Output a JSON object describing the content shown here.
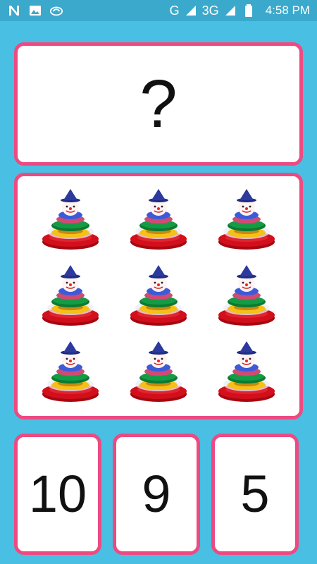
{
  "status_bar": {
    "left_icons": [
      "n-icon",
      "image-icon",
      "cloud-icon"
    ],
    "network_g": "G",
    "network_3g": "3G",
    "time": "4:58 PM"
  },
  "question": {
    "text": "?"
  },
  "objects": {
    "name": "stacking-ring-toy-icon",
    "count": 9,
    "colors": {
      "hat": "#2b3a9c",
      "face": "#fff3f3",
      "blue_ring": "#3d5bd8",
      "pink_ring": "#d14a74",
      "green_ring": "#0d8a3b",
      "yellow_ring": "#f5c018",
      "base": "#d30f1b"
    }
  },
  "answers": [
    {
      "label": "10"
    },
    {
      "label": "9"
    },
    {
      "label": "5"
    }
  ]
}
